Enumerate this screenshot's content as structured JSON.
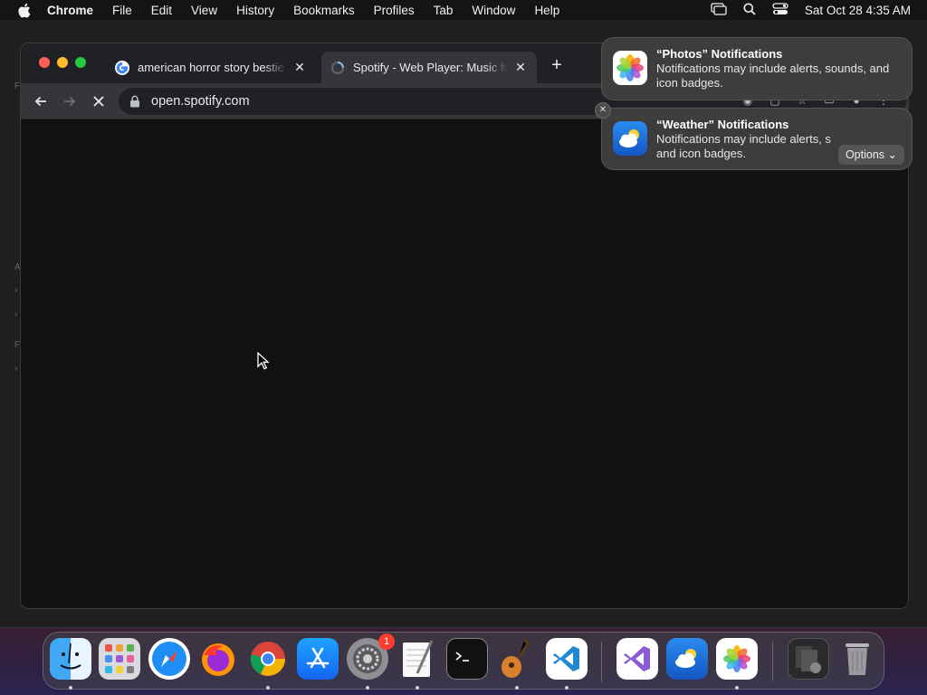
{
  "menubar": {
    "app_name": "Chrome",
    "items": [
      "File",
      "Edit",
      "View",
      "History",
      "Bookmarks",
      "Profiles",
      "Tab",
      "Window",
      "Help"
    ],
    "clock": "Sat Oct 28  4:35 AM"
  },
  "browser": {
    "tabs": [
      {
        "title": "american horror story bestie -",
        "favicon": "google-g-icon",
        "active": false
      },
      {
        "title": "Spotify - Web Player: Music fo",
        "favicon": "loading-spinner-icon",
        "active": true
      }
    ],
    "new_tab_label": "+",
    "url": "open.spotify.com"
  },
  "notifications": [
    {
      "title": "“Photos” Notifications",
      "body": "Notifications may include alerts, sounds, and icon badges.",
      "icon": "photos-app-icon"
    },
    {
      "title": "“Weather” Notifications",
      "body": "Notifications may include alerts, s and icon badges.",
      "icon": "weather-app-icon",
      "options_label": "Options"
    }
  ],
  "dock": {
    "apps": [
      "Finder",
      "Launchpad",
      "Safari",
      "Firefox",
      "Chrome",
      "App Store",
      "System Settings",
      "TextEdit",
      "Terminal",
      "GarageBand",
      "Visual Studio Code",
      "Visual Studio",
      "Weather",
      "Photos",
      "Downloads",
      "Trash"
    ],
    "settings_badge": "1"
  },
  "colors": {
    "menubar_bg": "#141414",
    "tab_active_bg": "#35363a",
    "viewport_bg": "#121212",
    "traffic_close": "#ff5f57",
    "traffic_min": "#febc2e",
    "traffic_max": "#28c840"
  }
}
